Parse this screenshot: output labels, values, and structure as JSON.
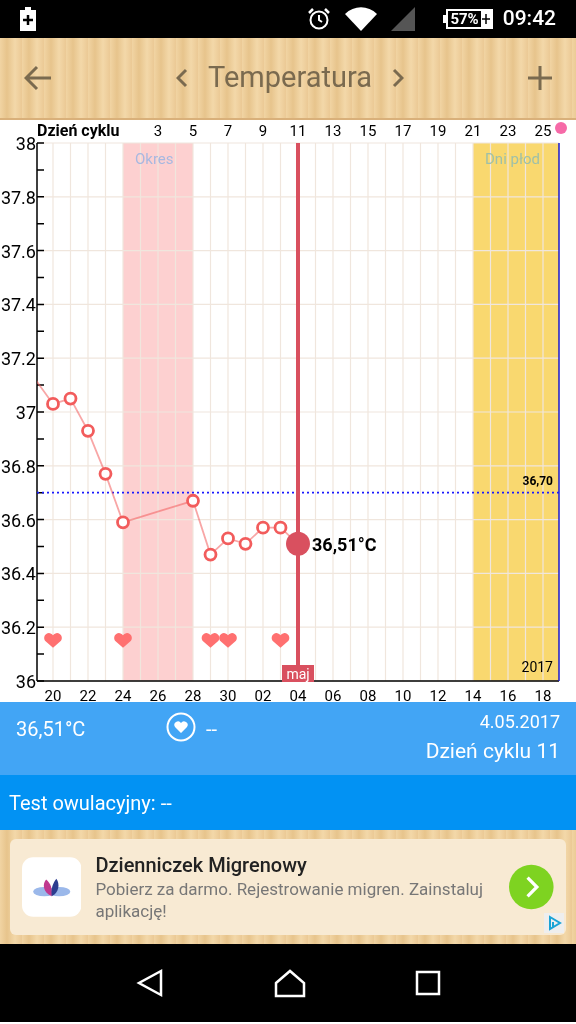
{
  "status_bar": {
    "battery": "57%",
    "time": "09:42"
  },
  "header": {
    "title": "Temperatura"
  },
  "chart": {
    "cycle_axis": {
      "title": "Dzień cyklu",
      "labels": [
        "3",
        "5",
        "7",
        "9",
        "11",
        "13",
        "15",
        "17",
        "19",
        "21",
        "23",
        "25"
      ]
    },
    "period_band": {
      "label": "Okres",
      "color": "#fdd0d0"
    },
    "fertile_band": {
      "label": "Dni płod",
      "color": "#f9d86f"
    },
    "month_label": "maj",
    "year_label": "2017",
    "chart_data": {
      "type": "line",
      "grid": true,
      "categories": [
        null,
        "20",
        null,
        "22",
        null,
        "24",
        null,
        "26",
        null,
        "28",
        null,
        "30",
        null,
        "02",
        null,
        "04",
        null,
        "06",
        null,
        "08",
        null,
        "10",
        null,
        "12",
        null,
        "14",
        null,
        "16",
        null,
        "18"
      ],
      "series": [
        {
          "type": "line",
          "marker": "circle",
          "color": "#f25c5c",
          "values": [
            37.12,
            37.03,
            37.05,
            36.93,
            36.77,
            36.59,
            null,
            null,
            null,
            36.67,
            36.47,
            36.53,
            36.51,
            36.57,
            36.57,
            36.51,
            null,
            null,
            null,
            null,
            null,
            null,
            null,
            null,
            null,
            null,
            null,
            null,
            null,
            null
          ]
        },
        {
          "type": "scatter",
          "color": "#ff7070",
          "values": [
            null,
            36.15,
            null,
            null,
            null,
            36.15,
            null,
            null,
            null,
            null,
            36.15,
            36.15,
            null,
            null,
            36.15,
            null,
            null,
            null,
            null,
            null,
            null,
            null,
            null,
            null,
            null,
            null,
            null,
            null,
            null,
            null
          ]
        }
      ],
      "ylim": [
        36,
        38
      ],
      "yticks": [
        36,
        36.2,
        36.4,
        36.6,
        36.8,
        37,
        37.2,
        37.4,
        37.6,
        37.8,
        38
      ],
      "ref_lines": [
        {
          "axis": "y",
          "value": 36.7,
          "label": "36,70"
        },
        {
          "axis": "x",
          "value": "04"
        }
      ],
      "annotations": [
        {
          "x": "04",
          "y": 36.51,
          "text": "36,51°C"
        }
      ]
    }
  },
  "summary": {
    "temperature": "36,51°C",
    "intercourse": "--",
    "date": "4.05.2017",
    "cycle_day": "Dzień cyklu 11"
  },
  "ovulation_test": {
    "label": "Test owulacyjny: --"
  },
  "ad": {
    "title": "Dzienniczek Migrenowy",
    "description": "Pobierz za darmo. Rejestrowanie migren. Zainstaluj aplikację!"
  }
}
